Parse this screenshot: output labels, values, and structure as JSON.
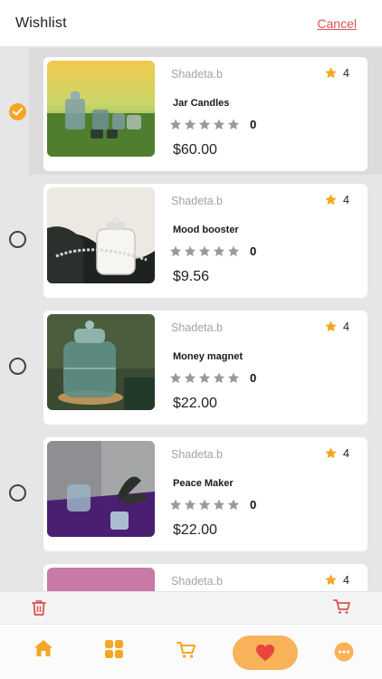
{
  "header": {
    "title": "Wishlist",
    "cancel_label": "Cancel"
  },
  "items": [
    {
      "brand": "Shadeta.b",
      "rating": "4",
      "name": "Jar Candles",
      "review_count": "0",
      "price": "$60.00",
      "selected": true
    },
    {
      "brand": "Shadeta.b",
      "rating": "4",
      "name": "Mood booster",
      "review_count": "0",
      "price": "$9.56",
      "selected": false
    },
    {
      "brand": "Shadeta.b",
      "rating": "4",
      "name": "Money magnet",
      "review_count": "0",
      "price": "$22.00",
      "selected": false
    },
    {
      "brand": "Shadeta.b",
      "rating": "4",
      "name": "Peace Maker",
      "review_count": "0",
      "price": "$22.00",
      "selected": false
    },
    {
      "brand": "Shadeta.b",
      "rating": "4"
    }
  ],
  "action_bar": {
    "left_icon": "trash-icon",
    "right_icon": "cart-icon"
  },
  "tabbar": {
    "tabs": [
      "home-icon",
      "categories-icon",
      "cart-icon",
      "wishlist-heart-icon",
      "more-icon"
    ],
    "active": "wishlist-heart-icon"
  },
  "colors": {
    "accent": "#f5a623",
    "pill": "#f7b25a",
    "heart": "#e8453c",
    "cancel": "#d9534f",
    "star_filled": "#f5a623",
    "star_empty": "#9a9a9a"
  }
}
